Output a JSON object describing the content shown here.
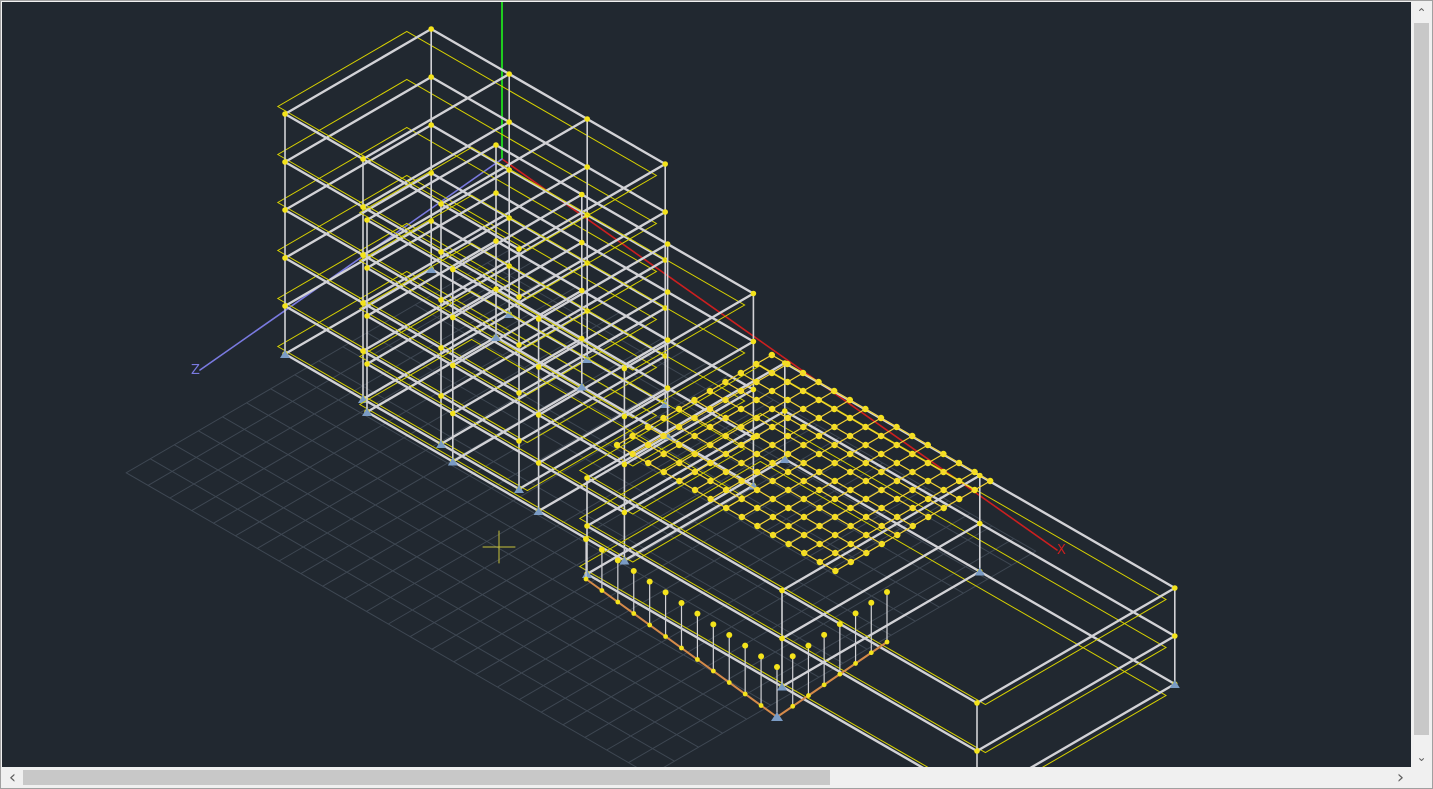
{
  "viewport": {
    "background": "#212830",
    "axes": {
      "x": {
        "label": "X",
        "color": "#cc1f1f"
      },
      "y": {
        "label": "",
        "color": "#1fcc1f"
      },
      "z": {
        "label": "Z",
        "color": "#7a7ae0"
      }
    },
    "colors": {
      "member": "#d2d2d6",
      "slab_outline": "#d8d200",
      "node": "#f4e31b",
      "selected_mesh": "#f5d535",
      "grid": "#3e4752",
      "support_edge": "#d58a4a"
    },
    "cursor_icon": "crosshair-icon"
  },
  "scrollbars": {
    "vertical": {
      "up_icon": "chevron-up-icon",
      "down_icon": "chevron-down-icon",
      "thumb_fraction": 0.93
    },
    "horizontal": {
      "left_icon": "chevron-left-icon",
      "right_icon": "chevron-right-icon",
      "thumb_fraction": 0.57
    },
    "glyphs": {
      "up": "⌃",
      "down": "⌄",
      "left": "‹",
      "right": "›"
    }
  }
}
